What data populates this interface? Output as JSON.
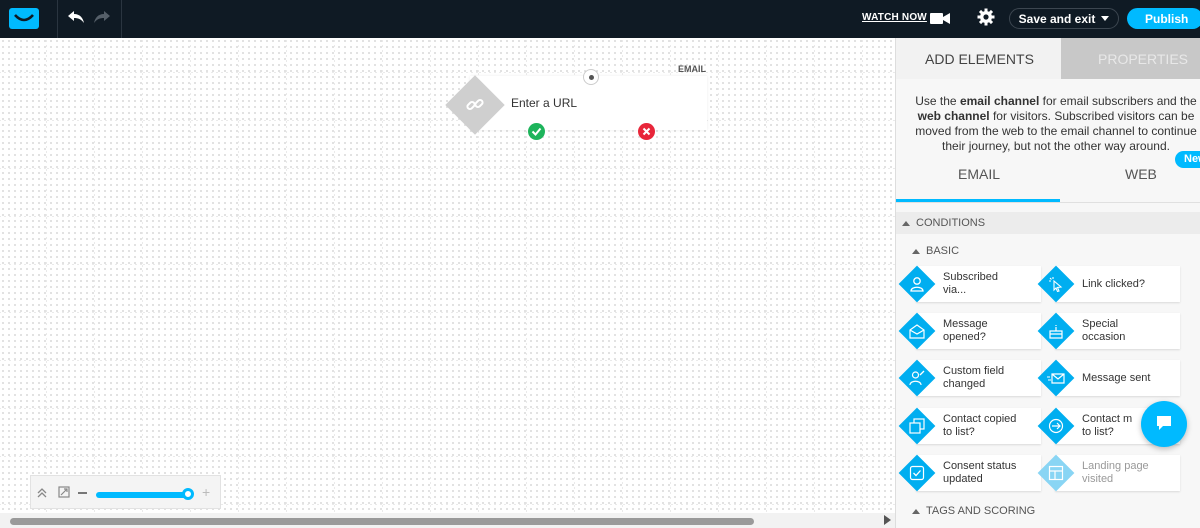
{
  "topbar": {
    "watch_now": "WATCH NOW",
    "save_and_exit": "Save and exit",
    "publish": "Publish"
  },
  "canvas": {
    "node": {
      "label": "EMAIL",
      "text": "Enter a URL"
    }
  },
  "panel": {
    "tabs": {
      "add": "ADD ELEMENTS",
      "properties": "PROPERTIES"
    },
    "description_parts": [
      "Use the ",
      "email channel",
      " for email subscribers and the ",
      "web channel",
      " for visitors. Subscribed visitors can be moved from the web to the email channel to continue their journey, but not the other way around."
    ],
    "new_badge": "New",
    "channel_tabs": [
      "EMAIL",
      "WEB"
    ],
    "conditions": "CONDITIONS",
    "basic": "BASIC",
    "elements": [
      {
        "l1": "Subscribed",
        "l2": "via...",
        "icon": "person-icon"
      },
      {
        "l1": "Link clicked?",
        "l2": "",
        "icon": "cursor-click-icon"
      },
      {
        "l1": "Message",
        "l2": "opened?",
        "icon": "envelope-open-icon"
      },
      {
        "l1": "Special",
        "l2": "occasion",
        "icon": "cake-icon"
      },
      {
        "l1": "Custom field",
        "l2": "changed",
        "icon": "person-edit-icon"
      },
      {
        "l1": "Message sent",
        "l2": "",
        "icon": "envelope-send-icon"
      },
      {
        "l1": "Contact copied",
        "l2": "to list?",
        "icon": "copy-icon"
      },
      {
        "l1": "Contact m",
        "l2": "to list?",
        "icon": "move-arrow-icon"
      },
      {
        "l1": "Consent status",
        "l2": "updated",
        "icon": "checkbox-icon"
      },
      {
        "l1": "Landing page",
        "l2": "visited",
        "icon": "layout-icon"
      }
    ],
    "tags_and_scoring": "TAGS AND SCORING"
  },
  "colors": {
    "accent": "#00baff",
    "topbar": "#0f1a24",
    "yes": "#1db45b",
    "no": "#e8263a"
  }
}
